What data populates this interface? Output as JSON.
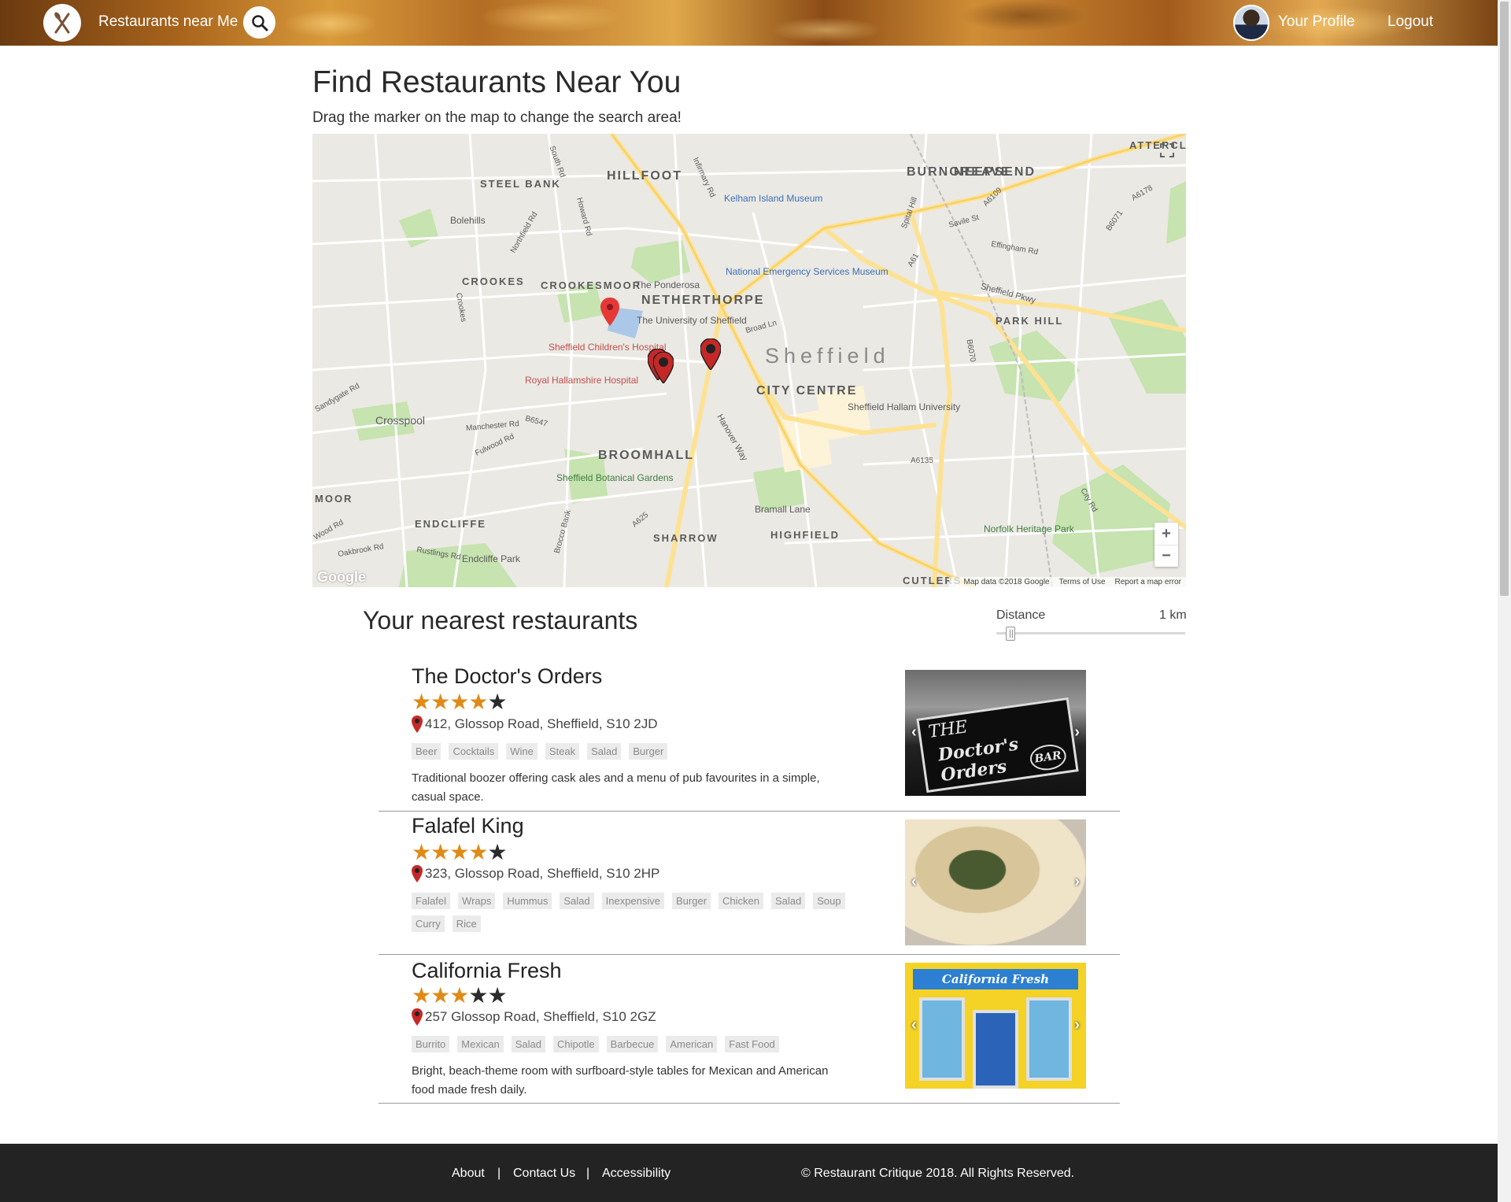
{
  "header": {
    "brand": "Restaurants near Me",
    "profile_label": "Your Profile",
    "logout_label": "Logout"
  },
  "main": {
    "title": "Find Restaurants Near You",
    "subtitle": "Drag the marker on the map to change the search area!"
  },
  "map": {
    "city": "Sheffield",
    "districts": [
      "HILLFOOT",
      "NEEPSEND",
      "BURNGREAVE",
      "STEEL BANK",
      "CROOKES",
      "CROOKESMOOR",
      "NETHERTHORPE",
      "PARK HILL",
      "CITY CENTRE",
      "BROOMHALL",
      "MOOR",
      "ENDCLIFFE",
      "SHARROW",
      "HIGHFIELD",
      "CUTLERS",
      "ATTERCLI"
    ],
    "places": {
      "bolehills": "Bolehills",
      "kelham": "Kelham Island Museum",
      "emergency": "National Emergency Services Museum",
      "ponderosa": "The Ponderosa",
      "university": "The University of Sheffield",
      "childrens": "Sheffield Children's Hospital",
      "hallamshire": "Royal Hallamshire Hospital",
      "crosspool": "Crosspool",
      "hallam_uni": "Sheffield Hallam University",
      "botanical": "Sheffield Botanical Gardens",
      "bramall": "Bramall Lane",
      "norfolk": "Norfolk Heritage Park",
      "endcliffe_park": "Endcliffe Park"
    },
    "roads": [
      "South Rd",
      "Howard Rd",
      "Infirmary Rd",
      "Northfield Rd",
      "Crookes",
      "Broad Ln",
      "Sandygate Rd",
      "Manchester Rd",
      "Fulwood Rd",
      "B6547",
      "Hanover Way",
      "Spital Hill",
      "Savile St",
      "A6109",
      "A6178",
      "B6071",
      "Effingham Rd",
      "Sheffield Pkwy",
      "A61",
      "B6070",
      "A6135",
      "City Rd",
      "A625",
      "Brocco Bank",
      "Rustlings Rd",
      "Oakbrook Rd",
      "Wood Rd"
    ],
    "zoom_in": "+",
    "zoom_out": "−",
    "google": "Google",
    "credits": [
      "Map data ©2018 Google",
      "Terms of Use",
      "Report a map error"
    ]
  },
  "results": {
    "title": "Your nearest restaurants",
    "distance_label": "Distance",
    "distance_value": "1 km",
    "distance_km": 1
  },
  "restaurants": [
    {
      "name": "The Doctor's Orders",
      "rating": 4,
      "address": "412, Glossop Road, Sheffield, S10 2JD",
      "tags": [
        "Beer",
        "Cocktails",
        "Wine",
        "Steak",
        "Salad",
        "Burger"
      ],
      "description": "Traditional boozer offering cask ales and a menu of pub favourites in a simple, casual space.",
      "photo_text": [
        "THE",
        "Doctor's Orders",
        "BAR"
      ]
    },
    {
      "name": "Falafel King",
      "rating": 4,
      "address": "323, Glossop Road, Sheffield, S10 2HP",
      "tags": [
        "Falafel",
        "Wraps",
        "Hummus",
        "Salad",
        "Inexpensive",
        "Burger",
        "Chicken",
        "Salad",
        "Soup",
        "Curry",
        "Rice"
      ],
      "description": ""
    },
    {
      "name": "California Fresh",
      "rating": 3,
      "address": "257 Glossop Road, Sheffield, S10 2GZ",
      "tags": [
        "Burrito",
        "Mexican",
        "Salad",
        "Chipotle",
        "Barbecue",
        "American",
        "Fast Food"
      ],
      "description": "Bright, beach-theme room with surfboard-style tables for Mexican and American food made fresh daily.",
      "photo_text": [
        "California Fresh"
      ]
    }
  ],
  "footer": {
    "about": "About",
    "contact": "Contact Us",
    "accessibility": "Accessibility",
    "sep": "|",
    "copyright": "© Restaurant Critique 2018. All Rights Reserved."
  },
  "colors": {
    "star": "#e08a17",
    "footer": "#232323",
    "marker": "#d32f2f"
  }
}
